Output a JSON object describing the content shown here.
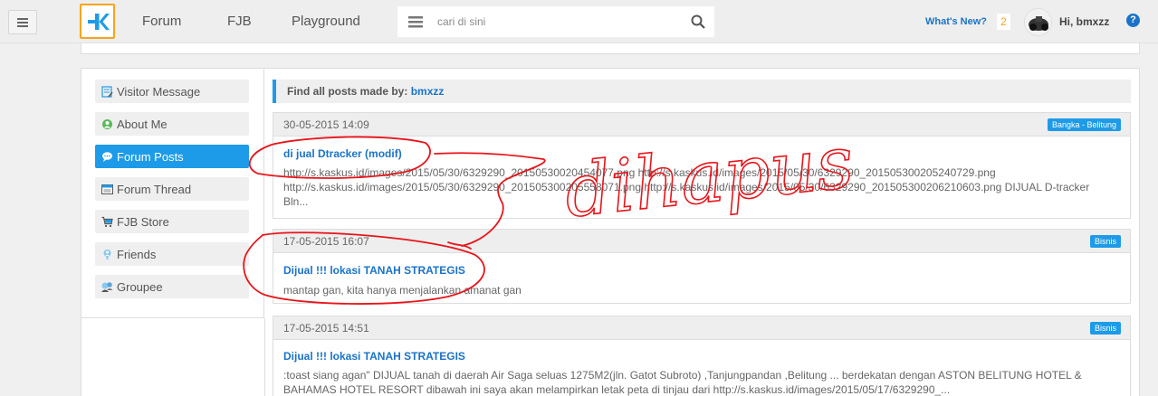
{
  "topbar": {
    "nav": [
      "Forum",
      "FJB",
      "Playground"
    ],
    "search_placeholder": "cari di sini",
    "whats_new": "What's New?",
    "notif_count": "2",
    "greeting": "Hi, bmxzz",
    "help": "?"
  },
  "sidebar": {
    "items": [
      {
        "label": "Visitor Message",
        "icon": "visitor-message-icon",
        "active": false
      },
      {
        "label": "About Me",
        "icon": "about-me-icon",
        "active": false
      },
      {
        "label": "Forum Posts",
        "icon": "forum-posts-icon",
        "active": true
      },
      {
        "label": "Forum Thread",
        "icon": "forum-thread-icon",
        "active": false
      },
      {
        "label": "FJB Store",
        "icon": "cart-icon",
        "active": false
      },
      {
        "label": "Friends",
        "icon": "friends-icon",
        "active": false
      },
      {
        "label": "Groupee",
        "icon": "groupee-icon",
        "active": false
      }
    ]
  },
  "main": {
    "title_prefix": "Find all posts made by:",
    "username": "bmxzz",
    "posts": [
      {
        "date": "30-05-2015 14:09",
        "badge": "Bangka - Belitung",
        "title": "di jual Dtracker (modif)",
        "body": "http://s.kaskus.id/images/2015/05/30/6329290_20150530020454077.png http://s.kaskus.id/images/2015/05/30/6329290_201505300205240729.png http://s.kaskus.id/images/2015/05/30/6329290_201505300205558071.png http://s.kaskus.id/images/2015/05/30/6329290_201505300206210603.png DIJUAL D-tracker Bln..."
      },
      {
        "date": "17-05-2015 16:07",
        "badge": "Bisnis",
        "title": "Dijual !!! lokasi TANAH STRATEGIS",
        "body": "mantap gan, kita hanya menjalankan amanat gan"
      },
      {
        "date": "17-05-2015 14:51",
        "badge": "Bisnis",
        "title": "Dijual !!! lokasi TANAH STRATEGIS",
        "body": ":toast siang agan\" DIJUAL tanah di daerah Air Saga seluas 1275M2(jln. Gatot Subroto) ,Tanjungpandan ,Belitung ... berdekatan dengan ASTON BELITUNG HOTEL & BAHAMAS HOTEL RESORT dibawah ini saya akan melampirkan letak peta di tinjau dari http://s.kaskus.id/images/2015/05/17/6329290_..."
      }
    ]
  },
  "annotation": {
    "text": "dihapus",
    "color": "#e8151b"
  },
  "colors": {
    "accent": "#1e9be8",
    "link": "#1a73c7",
    "logo_border": "#f7a41d"
  }
}
